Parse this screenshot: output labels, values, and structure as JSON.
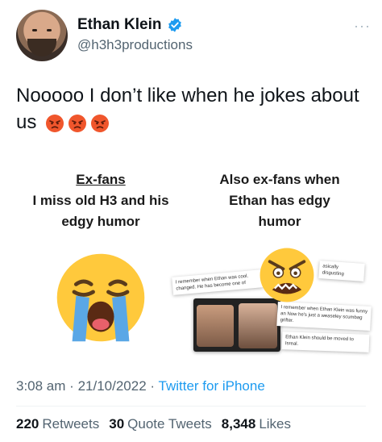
{
  "author": {
    "name": "Ethan Klein",
    "handle": "@h3h3productions"
  },
  "more_label": "···",
  "tweet": {
    "text": "Nooooo I don’t like when he jokes about us",
    "emojis": [
      "pouting-face",
      "pouting-face",
      "pouting-face"
    ]
  },
  "meme": {
    "left": {
      "title": "Ex-fans",
      "line1": "I miss old H3 and his",
      "line2": "edgy humor",
      "emoji": "loudly-crying-face"
    },
    "right": {
      "line1": "Also ex-fans when",
      "line2": "Ethan has edgy",
      "line3": "humor",
      "emoji": "angry-screaming-face",
      "snippets": {
        "s1": "I remember when Ethan was cool. changed. He has become one of",
        "s2": "asically disgusting",
        "s3": "I remember when Ethan Klein was funny an Now he's just a weaseley scumbag grifter.",
        "s4": "Ethan Klein should be moved to Isreal."
      }
    }
  },
  "meta": {
    "time": "3:08 am",
    "date": "21/10/2022",
    "source": "Twitter for iPhone"
  },
  "stats": {
    "retweets_count": "220",
    "retweets_label": "Retweets",
    "quotes_count": "30",
    "quotes_label": "Quote Tweets",
    "likes_count": "8,348",
    "likes_label": "Likes"
  },
  "colors": {
    "link": "#1d9bf0",
    "secondary_text": "#536471",
    "verified": "#1d9bf0"
  }
}
